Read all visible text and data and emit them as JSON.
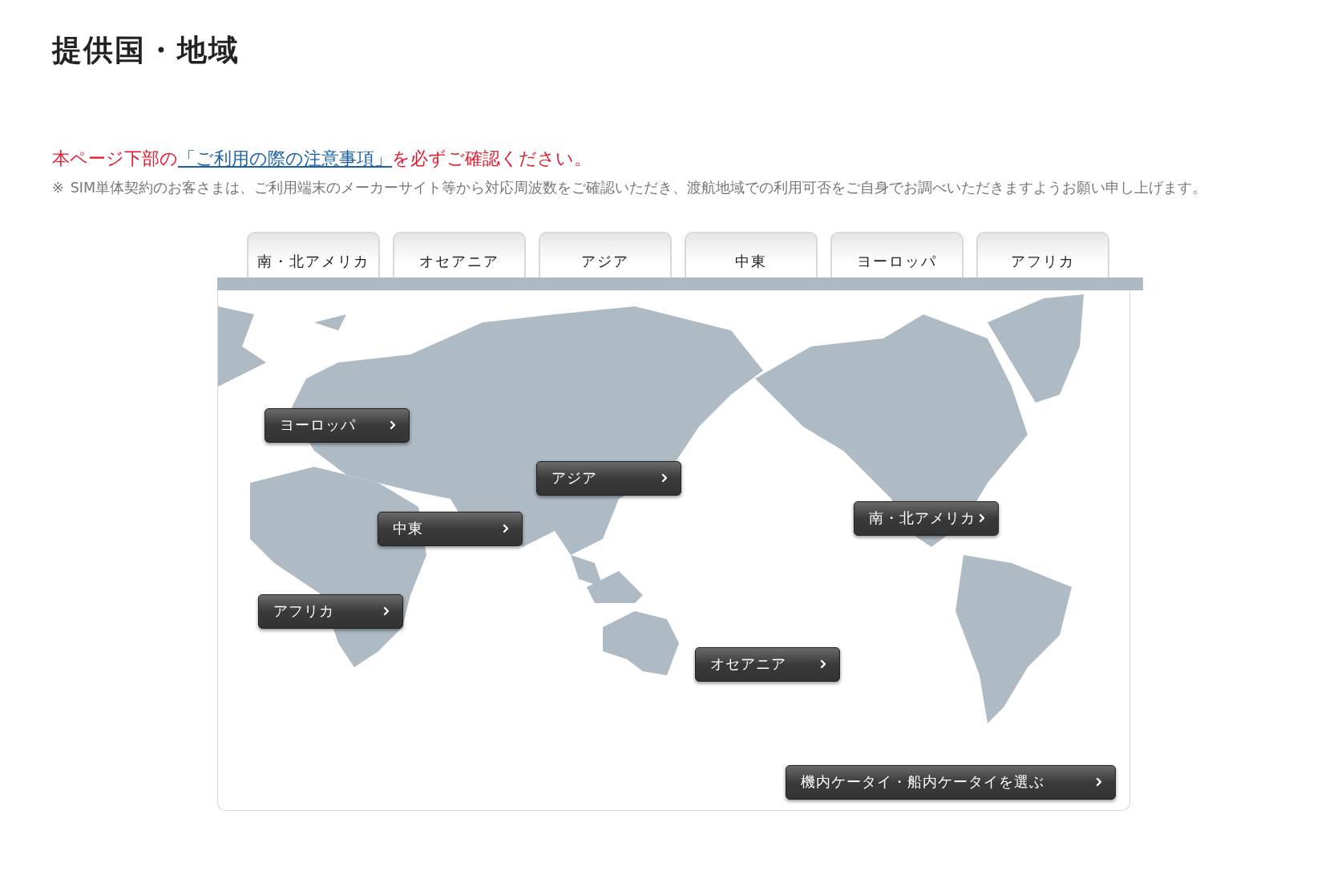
{
  "title": "提供国・地域",
  "notice": {
    "before": "本ページ下部の",
    "link": "「ご利用の際の注意事項」",
    "after": "を必ずご確認ください。"
  },
  "note": {
    "mark": "※",
    "text": "SIM単体契約のお客さまは、ご利用端末のメーカーサイト等から対応周波数をご確認いただき、渡航地域での利用可否をご自身でお調べいただきますようお願い申し上げます。"
  },
  "tabs": [
    {
      "label": "南・北アメリカ"
    },
    {
      "label": "オセアニア"
    },
    {
      "label": "アジア"
    },
    {
      "label": "中東"
    },
    {
      "label": "ヨーロッパ"
    },
    {
      "label": "アフリカ"
    }
  ],
  "map_buttons": [
    {
      "label": "ヨーロッパ"
    },
    {
      "label": "アジア"
    },
    {
      "label": "中東"
    },
    {
      "label": "南・北アメリカ"
    },
    {
      "label": "アフリカ"
    },
    {
      "label": "オセアニア"
    }
  ],
  "inflight_button": {
    "label": "機内ケータイ・船内ケータイを選ぶ"
  }
}
